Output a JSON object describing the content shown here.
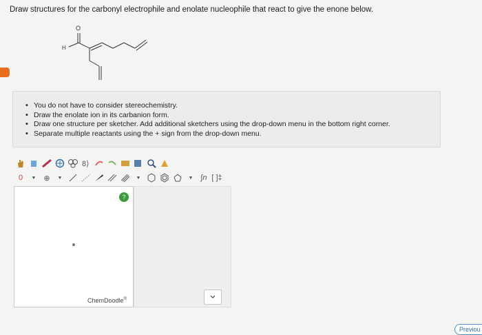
{
  "question": {
    "text": "Draw structures for the carbonyl electrophile and enolate nucleophile that react to give the enone below."
  },
  "molecule": {
    "oxygen_label": "O",
    "hydrogen_label": "H"
  },
  "instructions": {
    "items": [
      "You do not have to consider stereochemistry.",
      "Draw the enolate ion in its carbanion form.",
      "Draw one structure per sketcher. Add additional sketchers using the drop-down menu in the bottom right corner.",
      "Separate multiple reactants using the + sign from the drop-down menu."
    ]
  },
  "toolbar": {
    "row1": [
      "hand-icon",
      "eraser-icon",
      "pencil-icon",
      "ring-add-icon",
      "lasso-icon",
      "undo-icon",
      "redo-icon",
      "copy-icon",
      "paste-icon",
      "zoom-in-icon",
      "zoom-out-icon",
      "clean-icon"
    ],
    "row2_label_zero": "0",
    "row2_charge": "⊕",
    "row2_labels": [
      "∫n",
      "[ ]‡"
    ]
  },
  "sketcher": {
    "help_label": "?",
    "brand": "ChemDoodle",
    "brand_mark": "®"
  },
  "navigation": {
    "previous_label": "Previou"
  },
  "colors": {
    "accent_orange": "#e86d1f",
    "help_green": "#3c9a3c",
    "link_blue": "#2a6fa8"
  }
}
